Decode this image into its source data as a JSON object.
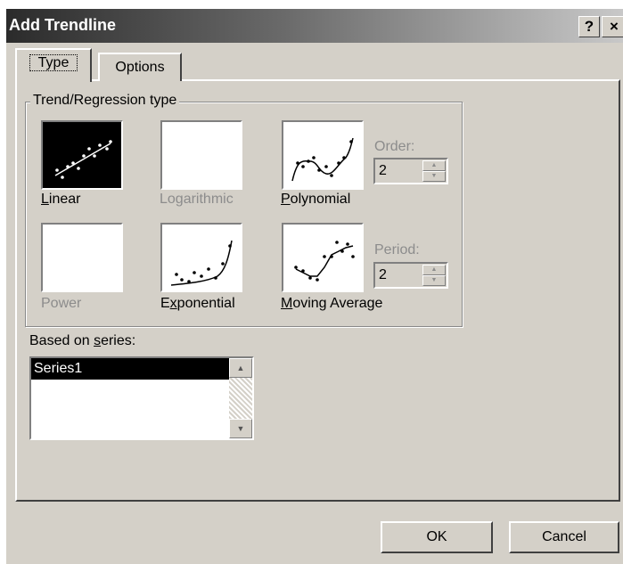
{
  "window": {
    "title": "Add Trendline",
    "help_label": "?",
    "close_label": "×"
  },
  "tabs": [
    {
      "label": "Type",
      "active": true
    },
    {
      "label": "Options",
      "active": false
    }
  ],
  "trend_group": {
    "label": "Trend/Regression type",
    "types": [
      {
        "label": "Linear",
        "mnemonic": "L",
        "rest": "inear",
        "enabled": true,
        "selected": true
      },
      {
        "label": "Logarithmic",
        "enabled": false,
        "selected": false
      },
      {
        "label": "Polynomial",
        "mnemonic": "P",
        "rest": "olynomial",
        "enabled": true,
        "selected": false
      },
      {
        "label": "Power",
        "enabled": false,
        "selected": false
      },
      {
        "label": "Exponential",
        "pre": "E",
        "mnemonic": "x",
        "rest": "ponential",
        "enabled": true,
        "selected": false
      },
      {
        "label": "Moving Average",
        "mnemonic": "M",
        "rest": "oving Average",
        "enabled": true,
        "selected": false
      }
    ],
    "order": {
      "label": "Order:",
      "value": "2",
      "enabled": false
    },
    "period": {
      "label": "Period:",
      "value": "2",
      "enabled": false
    }
  },
  "series": {
    "label_pre": "Based on ",
    "label_mnemonic": "s",
    "label_rest": "eries:",
    "items": [
      "Series1"
    ],
    "selected": "Series1"
  },
  "buttons": {
    "ok": "OK",
    "cancel": "Cancel"
  },
  "colors": {
    "face": "#d4d0c8",
    "selection": "#000000",
    "disabled_text": "#8c8c8c"
  }
}
